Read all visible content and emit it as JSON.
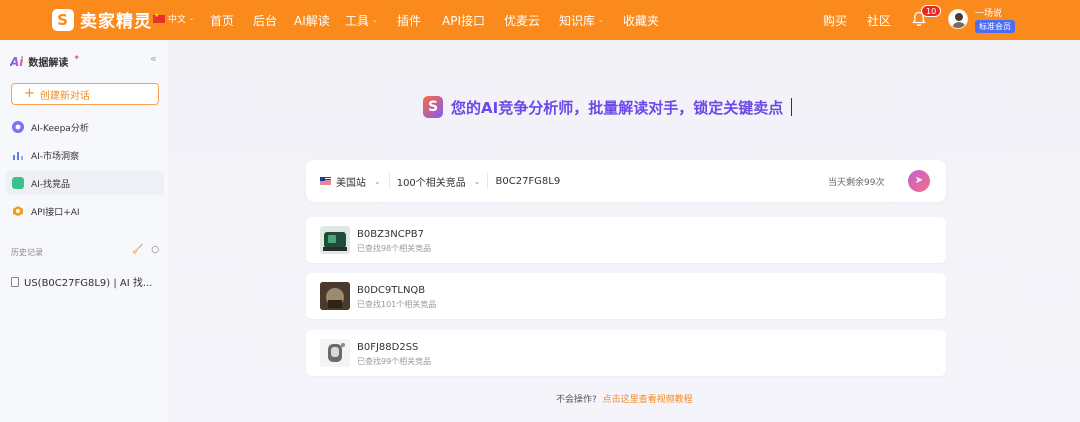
{
  "topbar": {
    "brand": "卖家精灵",
    "brand_mark": "S",
    "lang": "中文",
    "nav": [
      {
        "label": "首页",
        "dropdown": false
      },
      {
        "label": "后台",
        "dropdown": false
      },
      {
        "label": "AI解读",
        "dropdown": false
      },
      {
        "label": "工具",
        "dropdown": true
      },
      {
        "label": "插件",
        "dropdown": false
      },
      {
        "label": "API接口",
        "dropdown": false
      },
      {
        "label": "优麦云",
        "dropdown": false
      },
      {
        "label": "知识库",
        "dropdown": true
      },
      {
        "label": "收藏夹",
        "dropdown": false
      }
    ],
    "right_nav": [
      {
        "label": "购买"
      },
      {
        "label": "社区"
      }
    ],
    "notification_count": "10",
    "username": "一场说",
    "member_badge": "标准会员",
    "colors": {
      "bar": "#fb8a1c",
      "badge": "#e8281f",
      "member": "#4b6cf7"
    }
  },
  "sidebar": {
    "title": "数据解读",
    "title_prefix": "Ai",
    "collapse_icon": "double-chevron-left-icon",
    "new_chat_label": "创建新对话",
    "items": [
      {
        "label": "AI-Keepa分析",
        "icon": "keepa-icon",
        "active": false
      },
      {
        "label": "AI-市场洞察",
        "icon": "bar-chart-icon",
        "active": false
      },
      {
        "label": "AI-找竞品",
        "icon": "find-competitor-icon",
        "active": true
      },
      {
        "label": "API接口+AI",
        "icon": "api-icon",
        "active": false
      }
    ],
    "history_title": "历史记录",
    "history_items": [
      {
        "label": "US(B0C27FG8L9) | AI 找..."
      }
    ]
  },
  "main": {
    "hero_text": "您的AI竞争分析师，批量解读对手，锁定关键卖点",
    "search": {
      "marketplace": "美国站",
      "competitor_count": "100个相关竞品",
      "asin_value": "B0C27FG8L9",
      "quota": "当天剩余99次"
    },
    "results": [
      {
        "asin": "B0BZ3NCPB7",
        "sub": "已查找98个相关竞品",
        "thumb": "dark-green-device"
      },
      {
        "asin": "B0DC9TLNQB",
        "sub": "已查找101个相关竞品",
        "thumb": "brown-product"
      },
      {
        "asin": "B0FJ88D2SS",
        "sub": "已查找99个相关竞品",
        "thumb": "grey-device"
      }
    ],
    "help_text": "不会操作?",
    "help_link": "点击这里查看视频教程"
  }
}
